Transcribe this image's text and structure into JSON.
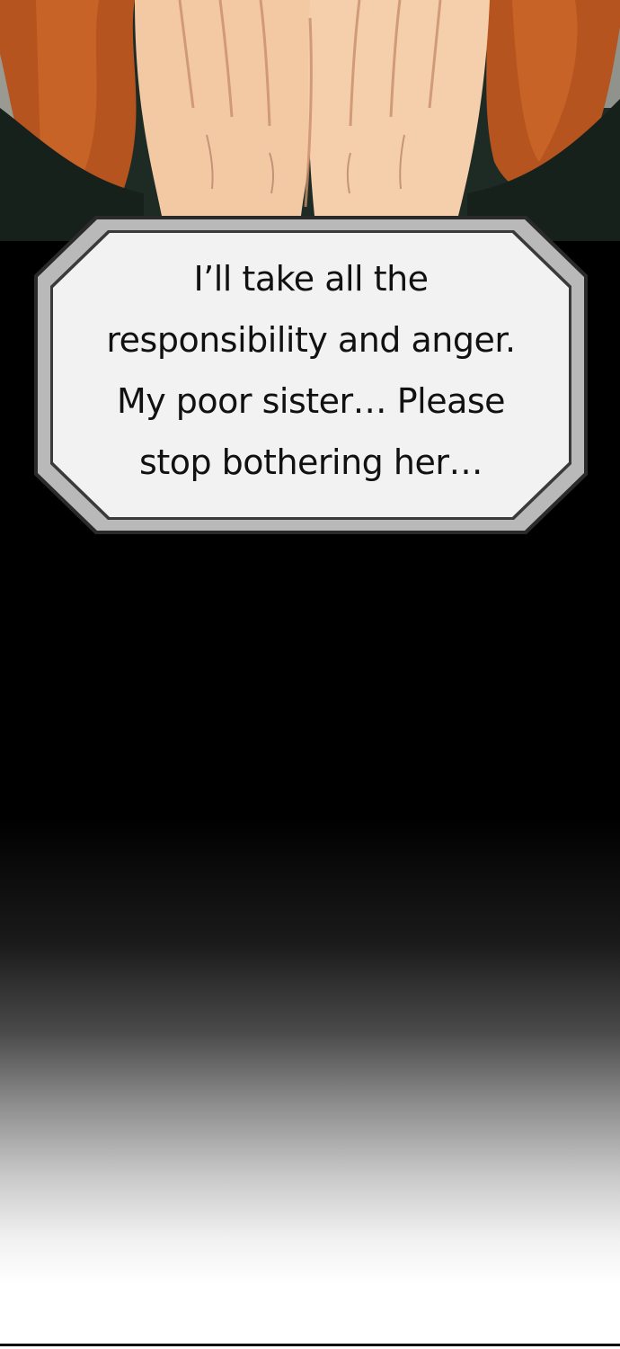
{
  "dialogue": {
    "lines": [
      "I’ll take all the",
      "responsibility and anger.",
      "My poor sister… Please",
      "stop bothering her…"
    ]
  },
  "colors": {
    "background": "#000000",
    "bubble_fill": "#f2f2f2",
    "bubble_border": "#b9b9b9",
    "hair": "#b5541f",
    "skin": "#f3c9a4",
    "jacket": "#1e2b25"
  }
}
